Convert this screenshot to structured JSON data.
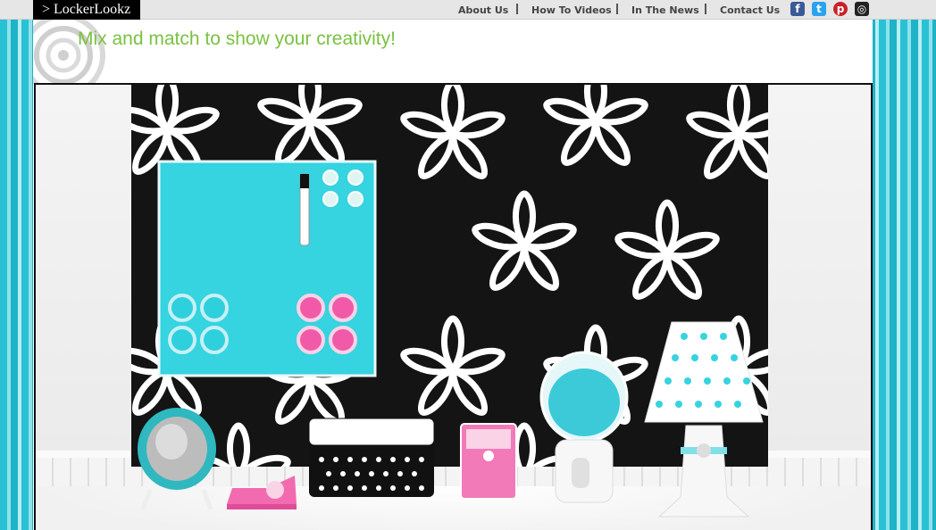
{
  "header": {
    "logo_text": "> LockerLookz",
    "nav": [
      {
        "label": "About Us"
      },
      {
        "label": "How To Videos"
      },
      {
        "label": "In The News"
      },
      {
        "label": "Contact Us"
      }
    ],
    "social": [
      {
        "icon": "facebook-icon",
        "glyph": "f",
        "color": "#3b5998"
      },
      {
        "icon": "twitter-icon",
        "glyph": "t",
        "color": "#2aa3ef"
      },
      {
        "icon": "pinterest-icon",
        "glyph": "p",
        "color": "#cb2027"
      },
      {
        "icon": "instagram-icon",
        "glyph": "◎",
        "color": "#222222"
      }
    ]
  },
  "page": {
    "tagline": "Mix and match to show your creativity!"
  },
  "hero": {
    "magnet_colors": {
      "teal": "#2fd0dd",
      "pink": "#f05aa8"
    },
    "accent_teal": "#36d3e0",
    "wallpaper_color": "#141414"
  }
}
